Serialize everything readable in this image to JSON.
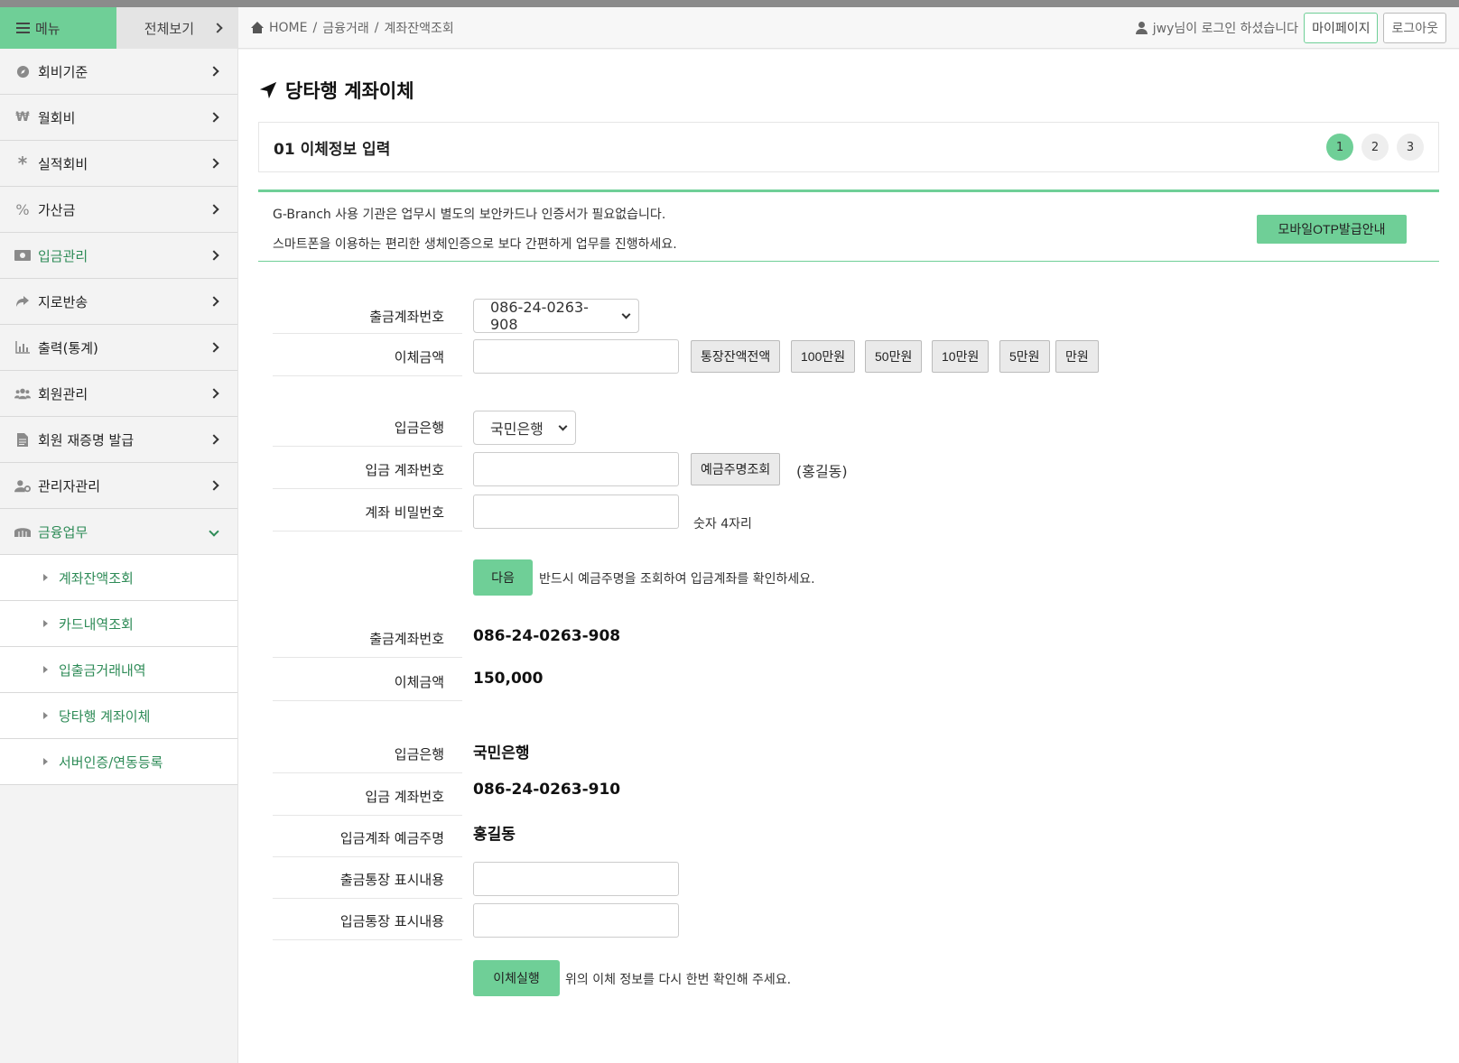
{
  "sidebar": {
    "menu_label": "메뉴",
    "view_all_label": "전체보기",
    "items": [
      {
        "label": "회비기준",
        "icon": "compass-icon"
      },
      {
        "label": "월회비",
        "icon": "won-icon"
      },
      {
        "label": "실적회비",
        "icon": "asterisk-icon"
      },
      {
        "label": "가산금",
        "icon": "percent-icon"
      },
      {
        "label": "입금관리",
        "icon": "money-icon"
      },
      {
        "label": "지로반송",
        "icon": "share-icon"
      },
      {
        "label": "출력(통계)",
        "icon": "chart-icon"
      },
      {
        "label": "회원관리",
        "icon": "users-icon"
      },
      {
        "label": "회원 재증명 발급",
        "icon": "document-icon"
      },
      {
        "label": "관리자관리",
        "icon": "user-gear-icon"
      },
      {
        "label": "금융업무",
        "icon": "bank-icon"
      }
    ],
    "sub_items": [
      "계좌잔액조회",
      "카드내역조회",
      "입출금거래내역",
      "당타행 계좌이체",
      "서버인증/연동등록"
    ]
  },
  "header": {
    "breadcrumb": [
      "HOME",
      "금융거래",
      "계좌잔액조회"
    ],
    "user_text": "jwy님이 로그인 하셨습니다",
    "mypage_label": "마이페이지",
    "logout_label": "로그아웃"
  },
  "page": {
    "title": "당타행 계좌이체",
    "step_title": "01 이체정보 입력",
    "steps": [
      "1",
      "2",
      "3"
    ],
    "notice_line1": "G-Branch 사용 기관은 업무시 별도의 보안카드나 인증서가 필요없습니다.",
    "notice_line2": "스마트폰을 이용하는 편리한 생체인증으로 보다 간편하게 업무를 진행하세요.",
    "otp_button": "모바일OTP발급안내"
  },
  "form": {
    "from_account_label": "출금계좌번호",
    "from_account_value": "086-24-0263-908",
    "amount_label": "이체금액",
    "amount_buttons": [
      "통장잔액전액",
      "100만원",
      "50만원",
      "10만원",
      "5만원",
      "만원"
    ],
    "bank_label": "입금은행",
    "bank_value": "국민은행",
    "to_account_label": "입금 계좌번호",
    "holder_button": "예금주명조회",
    "holder_result": "(홍길동)",
    "password_label": "계좌 비밀번호",
    "password_hint": "숫자 4자리",
    "next_button": "다음",
    "next_hint": "반드시 예금주명을 조회하여 입금계좌를 확인하세요."
  },
  "confirm": {
    "from_account_label": "출금계좌번호",
    "from_account_value": "086-24-0263-908",
    "amount_label": "이체금액",
    "amount_value": "150,000",
    "bank_label": "입금은행",
    "bank_value": "국민은행",
    "to_account_label": "입금 계좌번호",
    "to_account_value": "086-24-0263-910",
    "holder_label": "입금계좌 예금주명",
    "holder_value": "홍길동",
    "out_memo_label": "출금통장 표시내용",
    "in_memo_label": "입금통장 표시내용",
    "execute_button": "이체실행",
    "execute_hint": "위의 이체 정보를 다시 한번 확인해 주세요."
  },
  "colors": {
    "accent": "#6fcf97",
    "active_text": "#2e8b57"
  }
}
